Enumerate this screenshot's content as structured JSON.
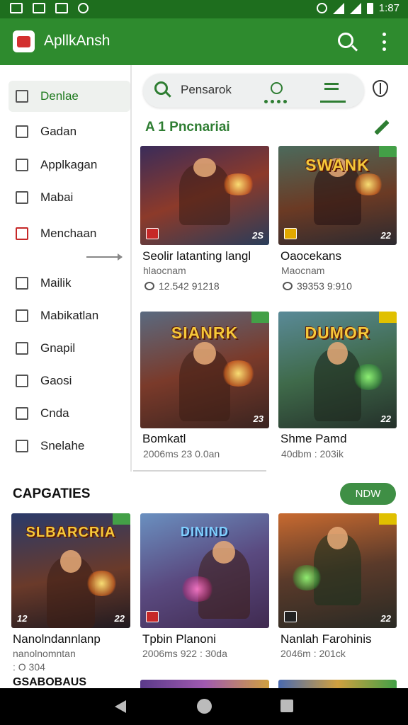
{
  "status": {
    "time": "1:87"
  },
  "appbar": {
    "title": "ApllkAnsh"
  },
  "drawer": {
    "items": [
      {
        "label": "Denlae",
        "active": true
      },
      {
        "label": "Gadan"
      },
      {
        "label": "Applkagan"
      },
      {
        "label": "Mabai"
      },
      {
        "label": "Menchaan"
      },
      {
        "label": "Mailik"
      },
      {
        "label": "Mabikatlan"
      },
      {
        "label": "Gnapil"
      },
      {
        "label": "Gaosi"
      },
      {
        "label": "Cnda"
      },
      {
        "label": "Snelahe"
      }
    ]
  },
  "search": {
    "placeholder": "Pensarok"
  },
  "section": {
    "title": "A 1 Pncnariai"
  },
  "featured": [
    {
      "title": "Seolir latanting langl",
      "subtitle": "hlaocnam",
      "meta": "12.542 91218",
      "logo": ""
    },
    {
      "title": "Oaocekans",
      "subtitle": "Maocnam",
      "meta": "39353 9:910",
      "logo": "SWANK"
    },
    {
      "title": "Bomkatl",
      "subtitle": "",
      "meta": "2006ms 23 0.0an",
      "logo": "SIANRK"
    },
    {
      "title": "Shme Pamd",
      "subtitle": "",
      "meta": "40dbm : 203ik",
      "logo": "DUMOR"
    }
  ],
  "categories": {
    "title": "CAPGATIES",
    "button": "NDW",
    "items": [
      {
        "title": "Nanolndannlanp",
        "subtitle": "nanolnomntan",
        "meta": ": O 304",
        "logo": "SLBARCRIA"
      },
      {
        "title": "Tpbin Planoni",
        "subtitle": "",
        "meta": "2006ms 922 : 30da",
        "logo": "DININD"
      },
      {
        "title": "Nanlah Farohinis",
        "subtitle": "",
        "meta": "2046m : 201ck",
        "logo": ""
      }
    ]
  },
  "bottom_label": "GSABOBAUS",
  "colors": {
    "primary": "#2e8b2e",
    "statusbar": "#1e6e1e",
    "accent": "#2e7d32",
    "badge_red": "#c62828"
  }
}
